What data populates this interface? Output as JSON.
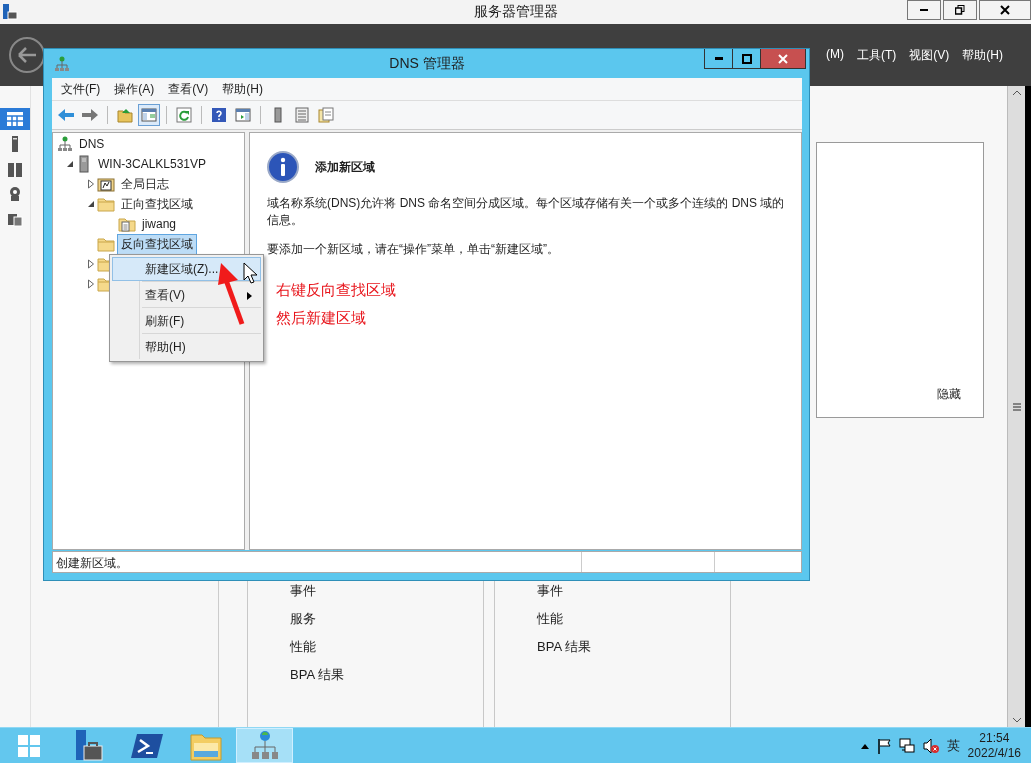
{
  "server_manager": {
    "title": "服务器管理器",
    "menu": [
      "(M)",
      "工具(T)",
      "视图(V)",
      "帮助(H)"
    ],
    "sidebar": [
      {
        "kind": "dashboard",
        "selected": true
      },
      {
        "kind": "local",
        "selected": false
      },
      {
        "kind": "all",
        "selected": false
      },
      {
        "kind": "roles",
        "selected": false
      },
      {
        "kind": "files",
        "selected": false
      }
    ],
    "panel_link": "隐藏",
    "tiles": [
      {
        "items": [
          "事件",
          "服务",
          "性能",
          "BPA 结果"
        ]
      },
      {
        "items": [
          "事件",
          "性能",
          "BPA 结果"
        ]
      }
    ]
  },
  "dns_window": {
    "title": "DNS 管理器",
    "menu": [
      "文件(F)",
      "操作(A)",
      "查看(V)",
      "帮助(H)"
    ],
    "toolbar": [
      {
        "kind": "back",
        "pressed": false
      },
      {
        "kind": "forward",
        "pressed": false
      },
      {
        "kind": "up",
        "pressed": false
      },
      {
        "kind": "tree",
        "pressed": true
      },
      {
        "kind": "refresh",
        "pressed": false
      },
      {
        "kind": "help",
        "pressed": false
      },
      {
        "kind": "pane",
        "pressed": false
      },
      {
        "kind": "server",
        "pressed": false
      },
      {
        "kind": "list",
        "pressed": false
      },
      {
        "kind": "export",
        "pressed": false
      }
    ],
    "tree": [
      {
        "label": "DNS",
        "kind": "root",
        "selected": false,
        "children": [
          {
            "label": "WIN-3CALKL531VP",
            "kind": "server",
            "expanded": true,
            "selected": false,
            "children": [
              {
                "label": "全局日志",
                "kind": "log",
                "expanded": false,
                "selected": false
              },
              {
                "label": "正向查找区域",
                "kind": "folder",
                "expanded": true,
                "selected": false,
                "children": [
                  {
                    "label": "jiwang",
                    "kind": "zone",
                    "selected": false
                  }
                ]
              },
              {
                "label": "反向查找区域",
                "kind": "folder",
                "selected": true
              },
              {
                "kind": "folder",
                "expanded": false,
                "selected": false
              },
              {
                "kind": "folder",
                "expanded": false,
                "selected": false
              }
            ]
          }
        ]
      }
    ],
    "detail": {
      "heading": "添加新区域",
      "paragraphs": [
        "域名称系统(DNS)允许将 DNS 命名空间分成区域。每个区域存储有关一个或多个连续的 DNS 域的信息。",
        "要添加一个新区域，请在“操作”菜单，单击“新建区域”。"
      ]
    },
    "status_bar": "创建新区域。"
  },
  "context_menu": [
    {
      "label": "新建区域(Z)...",
      "selected": true,
      "submenu": false
    },
    {
      "label": "查看(V)",
      "selected": false,
      "submenu": true
    },
    {
      "label": "刷新(F)",
      "selected": false,
      "submenu": false
    },
    {
      "label": "帮助(H)",
      "selected": false,
      "submenu": false
    }
  ],
  "annotations": [
    "右键反向查找区域",
    "然后新建区域"
  ],
  "taskbar": {
    "apps": [
      {
        "kind": "start",
        "selected": false
      },
      {
        "kind": "server-manager",
        "selected": false
      },
      {
        "kind": "powershell",
        "selected": false
      },
      {
        "kind": "explorer",
        "selected": false
      },
      {
        "kind": "dns",
        "selected": true
      }
    ],
    "ime": "英",
    "time": "21:54",
    "date": "2022/4/16"
  }
}
